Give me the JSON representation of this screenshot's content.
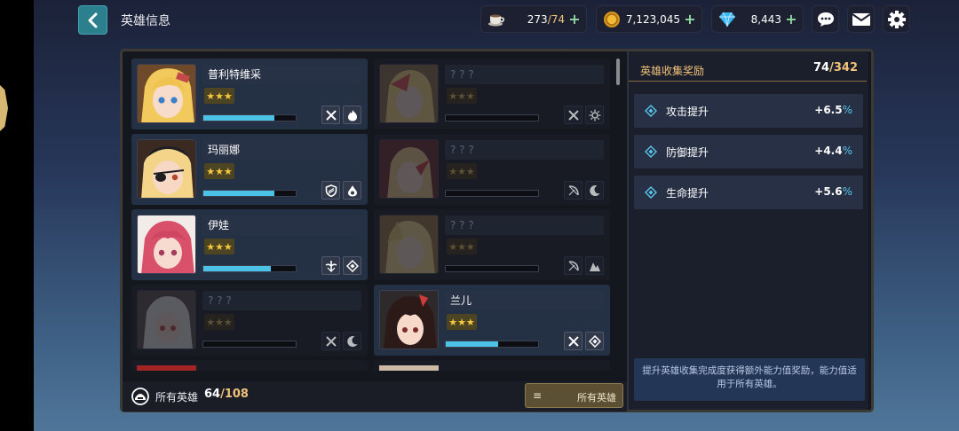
{
  "header": {
    "title": "英雄信息",
    "resources": [
      {
        "name": "stamina",
        "icon": "coffee-cup-icon",
        "value": "273",
        "max": "/74"
      },
      {
        "name": "gold",
        "icon": "gold-coin-icon",
        "value": "7,123,045"
      },
      {
        "name": "gems",
        "icon": "diamond-gem-icon",
        "value": "8,443"
      }
    ],
    "buttons": [
      "chat-bubble-icon",
      "mail-icon",
      "settings-gear-icon"
    ]
  },
  "heroes": [
    {
      "name": "普利特维采",
      "owned": true,
      "stars": "★★★",
      "progress": 0.77,
      "icons": [
        "crossed-swords-icon",
        "fire-icon"
      ]
    },
    {
      "name": "? ? ?",
      "owned": false,
      "stars": "★★★",
      "progress": 0,
      "icons": [
        "crossed-swords-icon",
        "sun-icon"
      ]
    },
    {
      "name": "玛丽娜",
      "owned": true,
      "stars": "★★★",
      "progress": 0.77,
      "icons": [
        "shield-icon",
        "water-drop-icon"
      ]
    },
    {
      "name": "? ? ?",
      "owned": false,
      "stars": "★★★",
      "progress": 0,
      "icons": [
        "bow-icon",
        "moon-icon"
      ]
    },
    {
      "name": "伊娃",
      "owned": true,
      "stars": "★★★",
      "progress": 0.73,
      "icons": [
        "healer-cross-icon",
        "diamond-icon"
      ]
    },
    {
      "name": "? ? ?",
      "owned": false,
      "stars": "★★★",
      "progress": 0,
      "icons": [
        "bow-icon",
        "mountain-icon"
      ]
    },
    {
      "name": "? ? ?",
      "owned": false,
      "stars": "★★★",
      "progress": 0,
      "icons": [
        "crossed-swords-icon",
        "moon-icon"
      ]
    },
    {
      "name": "兰儿",
      "owned": true,
      "stars": "★★★",
      "progress": 0.57,
      "icons": [
        "crossed-swords-icon",
        "diamond-icon"
      ]
    }
  ],
  "footer": {
    "label": "所有英雄",
    "count": "64",
    "total": "/108",
    "filter_icon": "≡",
    "filter_label": "所有英雄"
  },
  "reward": {
    "title": "英雄收集奖励",
    "count": "74",
    "total": "/342",
    "rows": [
      {
        "label": "攻击提升",
        "value": "+6.5",
        "unit": "%"
      },
      {
        "label": "防御提升",
        "value": "+4.4",
        "unit": "%"
      },
      {
        "label": "生命提升",
        "value": "+5.6",
        "unit": "%"
      }
    ],
    "note": "提升英雄收集完成度获得额外能力值奖励，能力值适用于所有英雄。"
  }
}
